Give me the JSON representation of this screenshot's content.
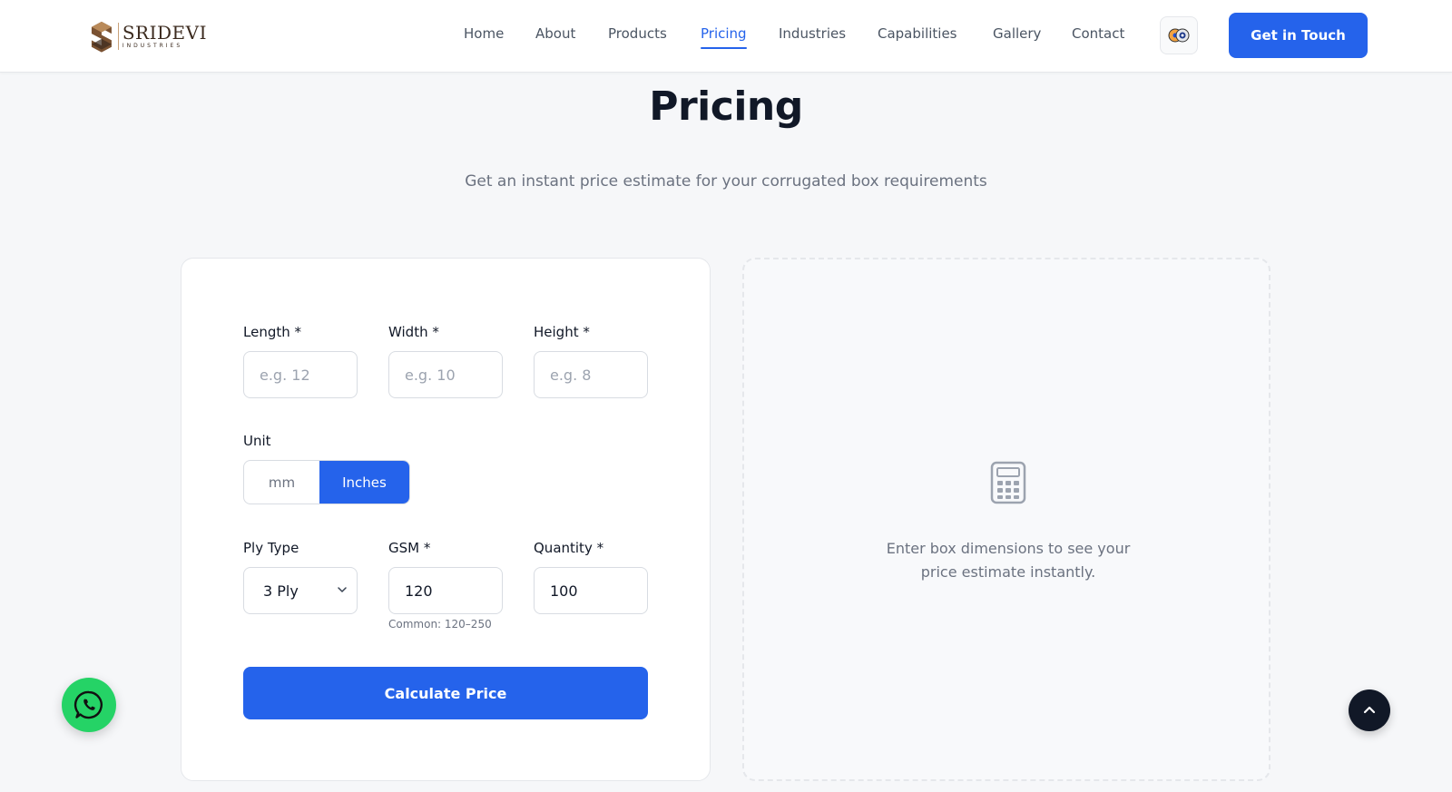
{
  "brand": {
    "name": "SRIDEVI",
    "tagline": "INDUSTRIES"
  },
  "nav": {
    "items": [
      {
        "label": "Home"
      },
      {
        "label": "About"
      },
      {
        "label": "Products"
      },
      {
        "label": "Pricing",
        "active": true
      },
      {
        "label": "Industries"
      },
      {
        "label": "Capabilities"
      },
      {
        "label": "Gallery"
      },
      {
        "label": "Contact"
      }
    ],
    "cta_label": "Get in Touch"
  },
  "page": {
    "title": "Pricing",
    "subtitle": "Get an instant price estimate for your corrugated box requirements"
  },
  "form": {
    "length": {
      "label": "Length *",
      "value": "",
      "placeholder": "e.g. 12"
    },
    "width": {
      "label": "Width *",
      "value": "",
      "placeholder": "e.g. 10"
    },
    "height": {
      "label": "Height *",
      "value": "",
      "placeholder": "e.g. 8"
    },
    "unit": {
      "label": "Unit",
      "options": [
        "mm",
        "Inches"
      ],
      "selected": "Inches"
    },
    "ply": {
      "label": "Ply Type",
      "value": "3 Ply"
    },
    "gsm": {
      "label": "GSM *",
      "value": "120",
      "hint": "Common: 120–250"
    },
    "quantity": {
      "label": "Quantity *",
      "value": "100"
    },
    "submit_label": "Calculate Price"
  },
  "result": {
    "message": "Enter box dimensions to see your price estimate instantly."
  },
  "colors": {
    "accent": "#2563eb",
    "whatsapp": "#25d366",
    "dark": "#111827"
  }
}
